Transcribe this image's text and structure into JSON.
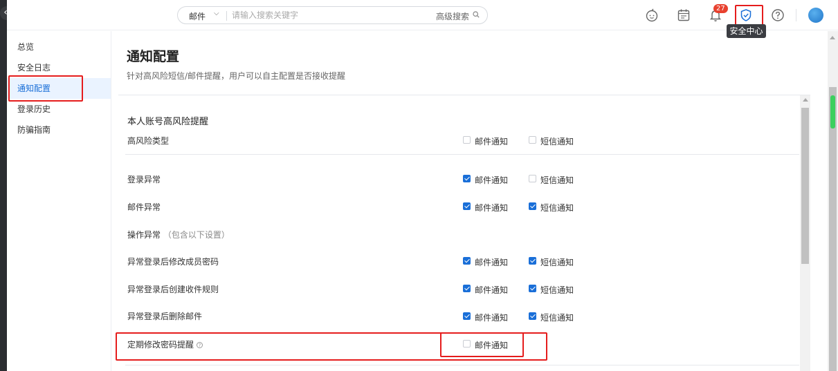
{
  "header": {
    "search": {
      "scope": "邮件",
      "placeholder": "请输入搜索关键字",
      "advanced_label": "高级搜索"
    },
    "notification_count": "27",
    "tooltip": "安全中心",
    "icons": [
      "robot-icon",
      "calendar-icon",
      "bell-icon",
      "shield-check-icon",
      "help-icon",
      "avatar"
    ]
  },
  "sidebar": {
    "items": [
      {
        "label": "总览",
        "active": false
      },
      {
        "label": "安全日志",
        "active": false
      },
      {
        "label": "通知配置",
        "active": true
      },
      {
        "label": "登录历史",
        "active": false
      },
      {
        "label": "防骗指南",
        "active": false
      }
    ]
  },
  "main": {
    "title": "通知配置",
    "description": "针对高风险短信/邮件提醒，用户可以自主配置是否接收提醒",
    "section_title": "本人账号高风险提醒",
    "type_row": {
      "label": "高风险类型",
      "email": "邮件通知",
      "sms": "短信通知"
    },
    "rows": [
      {
        "label": "登录异常",
        "email": "邮件通知",
        "email_checked": true,
        "sms": "短信通知",
        "sms_checked": false
      },
      {
        "label": "邮件异常",
        "email": "邮件通知",
        "email_checked": true,
        "sms": "短信通知",
        "sms_checked": true
      },
      {
        "label": "异常登录后修改成员密码",
        "email": "邮件通知",
        "email_checked": true,
        "sms": "短信通知",
        "sms_checked": true
      },
      {
        "label": "异常登录后创建收件规则",
        "email": "邮件通知",
        "email_checked": true,
        "sms": "短信通知",
        "sms_checked": true
      },
      {
        "label": "异常登录后删除邮件",
        "email": "邮件通知",
        "email_checked": true,
        "sms": "短信通知",
        "sms_checked": true
      }
    ],
    "op_group": {
      "label": "操作异常",
      "sub": "（包含以下设置）"
    },
    "periodic": {
      "label": "定期修改密码提醒",
      "help": "?",
      "email": "邮件通知",
      "email_checked": false
    }
  },
  "colors": {
    "accent": "#1a6fd8",
    "highlight": "#e51c1c",
    "badge": "#e8412f",
    "active_bg": "#eaf3ff"
  }
}
